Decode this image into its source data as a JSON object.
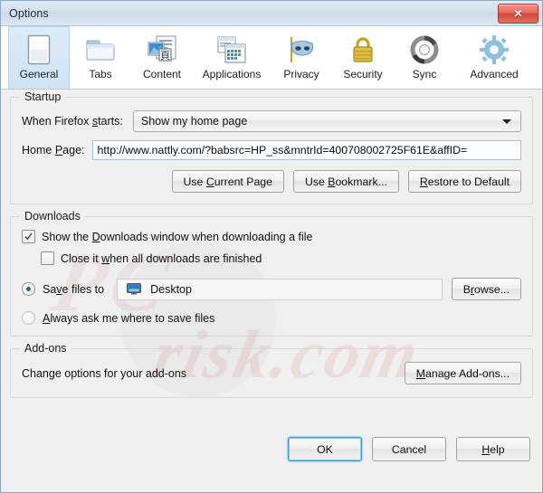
{
  "window": {
    "title": "Options",
    "close_label": "✕"
  },
  "tabs": [
    {
      "label": "General",
      "icon": "general-page-icon",
      "selected": true
    },
    {
      "label": "Tabs",
      "icon": "tabs-folder-icon",
      "selected": false
    },
    {
      "label": "Content",
      "icon": "content-image-icon",
      "selected": false
    },
    {
      "label": "Applications",
      "icon": "applications-window-icon",
      "selected": false
    },
    {
      "label": "Privacy",
      "icon": "privacy-mask-icon",
      "selected": false
    },
    {
      "label": "Security",
      "icon": "security-lock-icon",
      "selected": false
    },
    {
      "label": "Sync",
      "icon": "sync-arrows-icon",
      "selected": false
    },
    {
      "label": "Advanced",
      "icon": "advanced-gear-icon",
      "selected": false
    }
  ],
  "startup": {
    "legend": "Startup",
    "when_firefox_starts_label": "When Firefox starts:",
    "when_firefox_starts_value": "Show my home page",
    "home_page_label": "Home Page:",
    "home_page_value": "http://www.nattly.com/?babsrc=HP_ss&mntrId=400708002725F61E&affID=",
    "use_current_page": "Use Current Page",
    "use_bookmark": "Use Bookmark...",
    "restore_to_default": "Restore to Default"
  },
  "downloads": {
    "legend": "Downloads",
    "show_downloads_window_label": "Show the Downloads window when downloading a file",
    "show_downloads_window_checked": true,
    "close_when_finished_label": "Close it when all downloads are finished",
    "close_when_finished_checked": false,
    "save_files_to_label": "Save files to",
    "save_files_to_selected": true,
    "save_files_to_value": "Desktop",
    "browse_label": "Browse...",
    "always_ask_label": "Always ask me where to save files",
    "always_ask_selected": false
  },
  "addons": {
    "legend": "Add-ons",
    "description": "Change options for your add-ons",
    "manage_label": "Manage Add-ons..."
  },
  "footer": {
    "ok": "OK",
    "cancel": "Cancel",
    "help": "Help"
  },
  "watermark": {
    "line1": "PC",
    "line2": "risk.com"
  },
  "colors": {
    "accent": "#3c9ad6",
    "title_bar": "#d3e0ee",
    "close_red": "#d34638",
    "selected_tab": "#cfe4f5"
  }
}
